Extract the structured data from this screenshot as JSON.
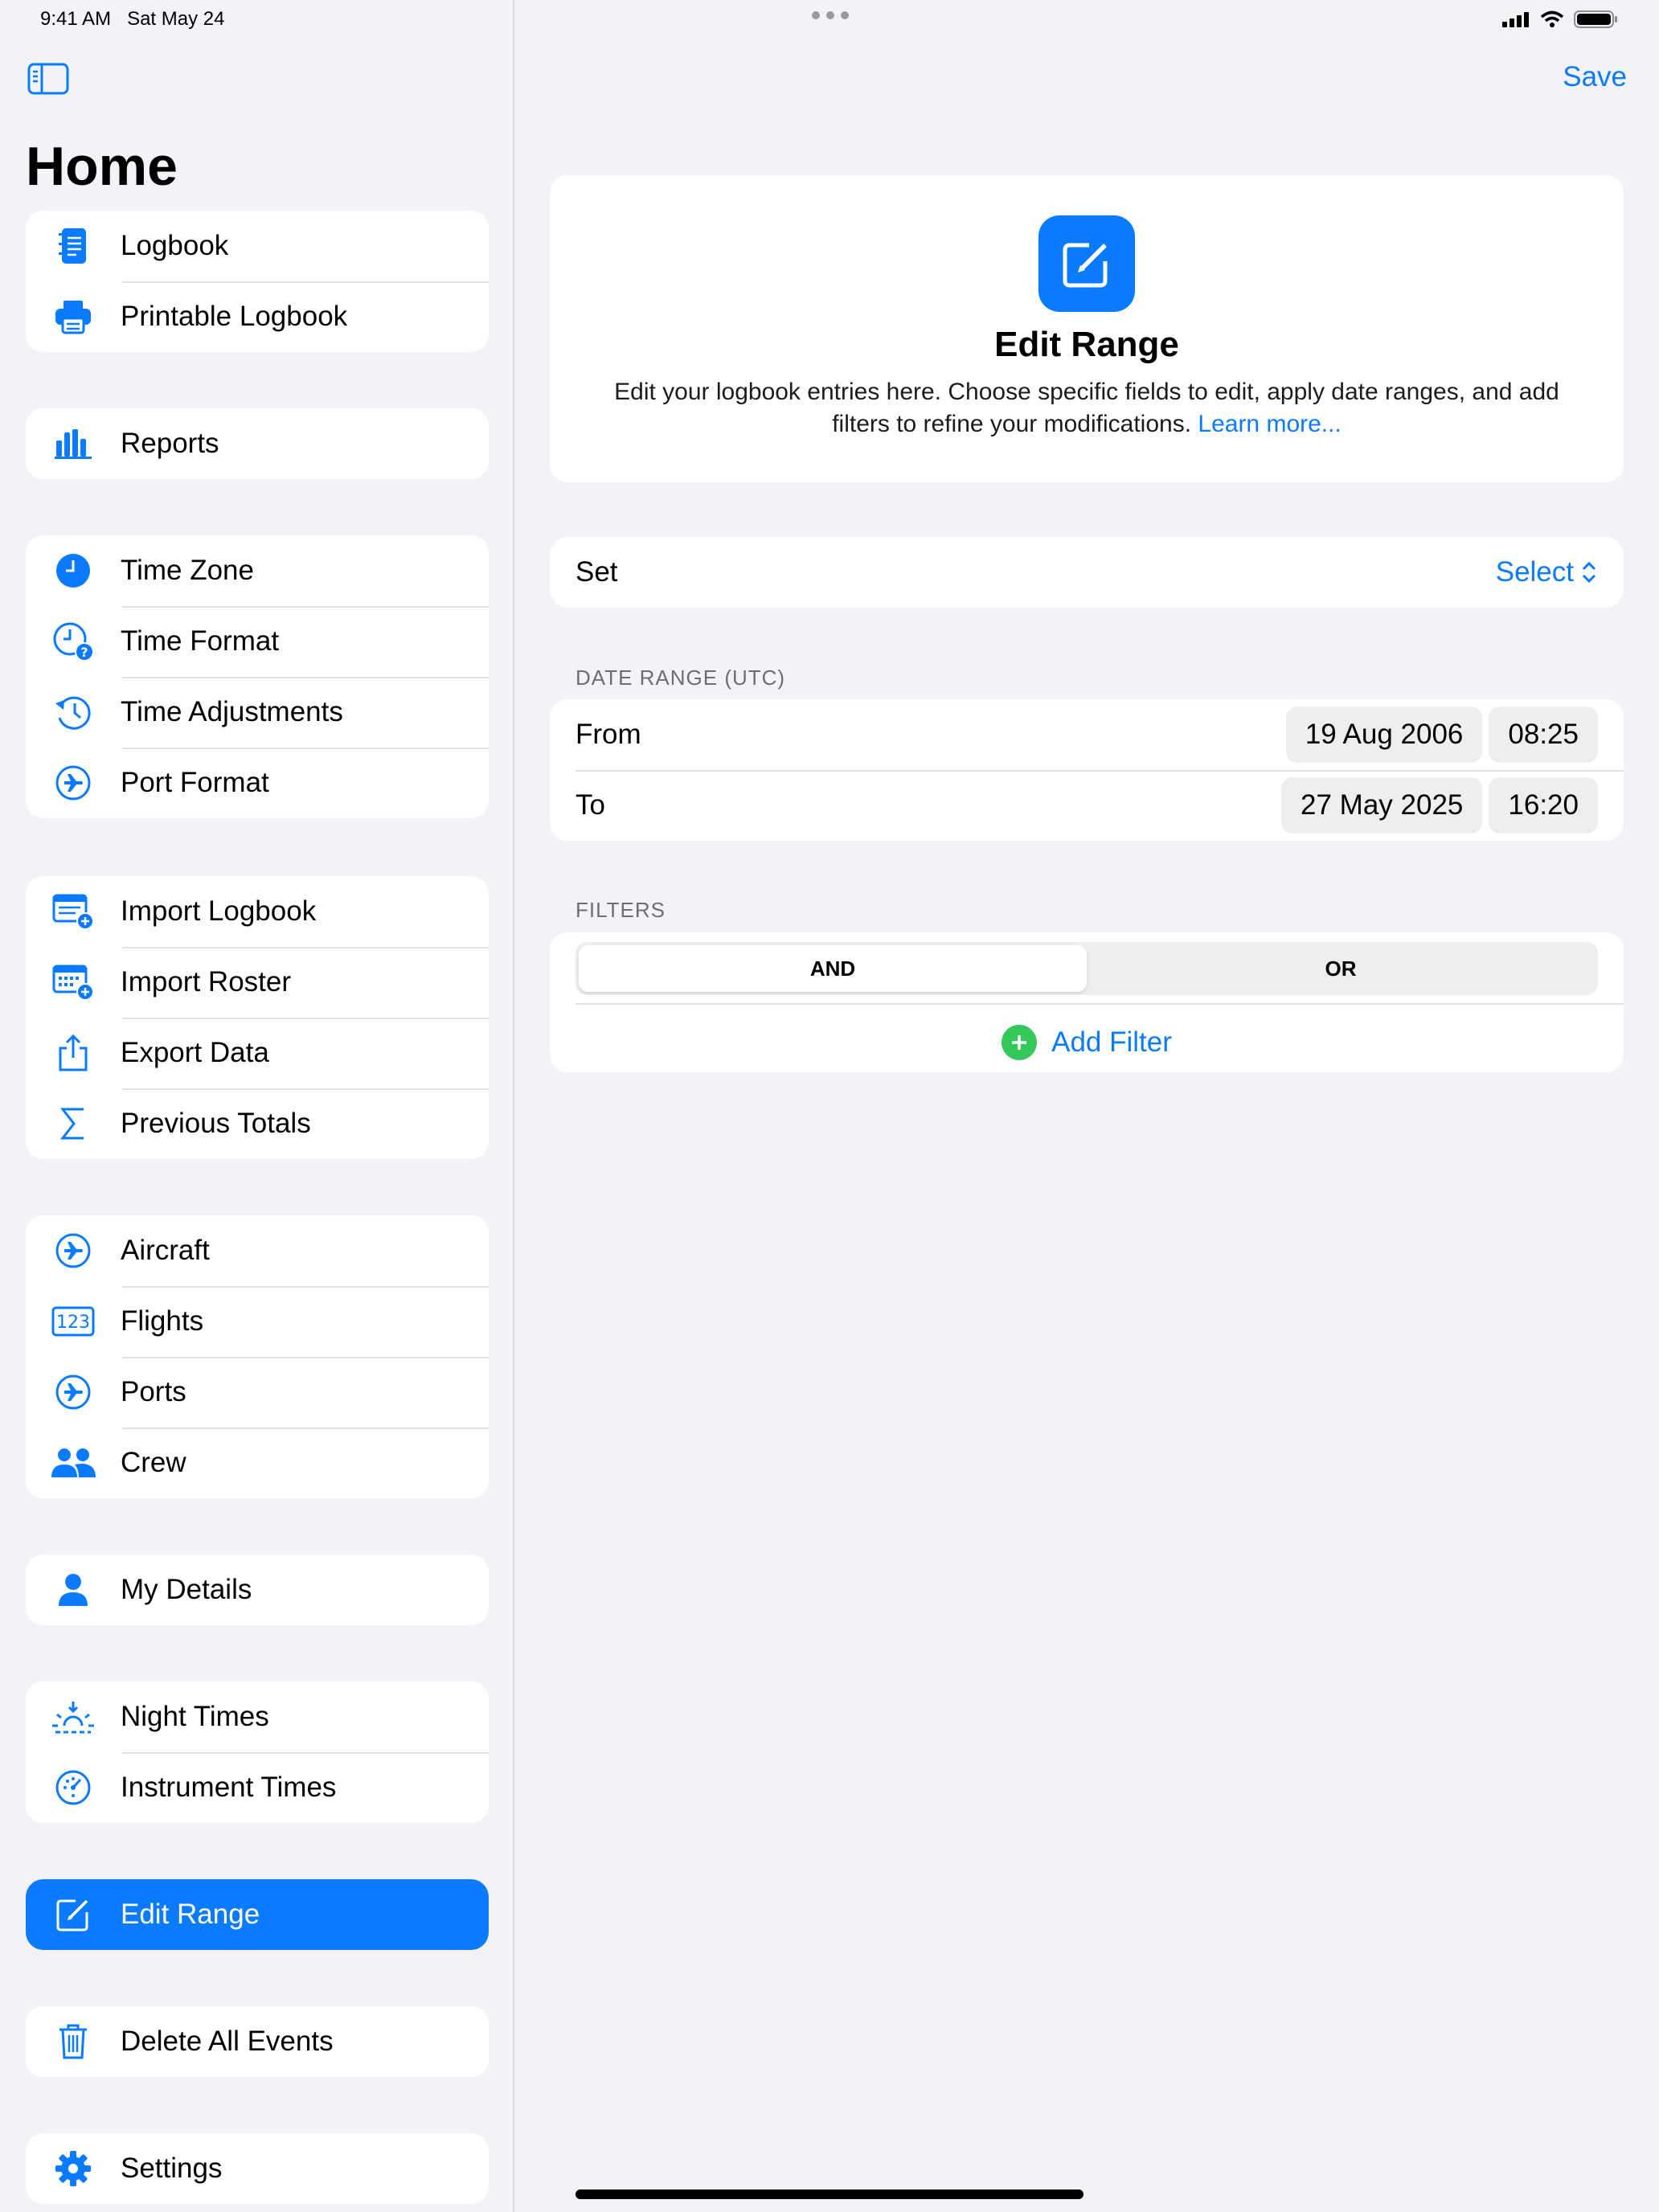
{
  "status_bar": {
    "time": "9:41 AM",
    "date": "Sat May 24"
  },
  "sidebar": {
    "title": "Home",
    "groups": [
      [
        {
          "label": "Logbook",
          "icon": "logbook-icon"
        },
        {
          "label": "Printable Logbook",
          "icon": "printer-icon"
        }
      ],
      [
        {
          "label": "Reports",
          "icon": "chart-bar-icon"
        }
      ],
      [
        {
          "label": "Time Zone",
          "icon": "clock-icon"
        },
        {
          "label": "Time Format",
          "icon": "clock-question-icon"
        },
        {
          "label": "Time Adjustments",
          "icon": "clock-arrow-icon"
        },
        {
          "label": "Port Format",
          "icon": "airplane-circle-icon"
        }
      ],
      [
        {
          "label": "Import Logbook",
          "icon": "import-list-icon"
        },
        {
          "label": "Import Roster",
          "icon": "import-calendar-icon"
        },
        {
          "label": "Export Data",
          "icon": "share-icon"
        },
        {
          "label": "Previous Totals",
          "icon": "sigma-icon"
        }
      ],
      [
        {
          "label": "Aircraft",
          "icon": "airplane-circle-icon"
        },
        {
          "label": "Flights",
          "icon": "number-123-icon"
        },
        {
          "label": "Ports",
          "icon": "airplane-circle-icon"
        },
        {
          "label": "Crew",
          "icon": "people-icon"
        }
      ],
      [
        {
          "label": "My Details",
          "icon": "person-icon"
        }
      ],
      [
        {
          "label": "Night Times",
          "icon": "sunset-icon"
        },
        {
          "label": "Instrument Times",
          "icon": "gauge-icon"
        }
      ],
      [
        {
          "label": "Edit Range",
          "icon": "edit-square-icon"
        }
      ],
      [
        {
          "label": "Delete All Events",
          "icon": "trash-icon"
        }
      ],
      [
        {
          "label": "Settings",
          "icon": "gear-icon"
        }
      ]
    ]
  },
  "toolbar": {
    "save_label": "Save"
  },
  "hero": {
    "title": "Edit Range",
    "description": "Edit your logbook entries here. Choose specific fields to edit, apply date ranges, and add filters to refine your modifications.",
    "link": "Learn more..."
  },
  "set": {
    "label": "Set",
    "value": "Select"
  },
  "date_range": {
    "header": "DATE RANGE (UTC)",
    "from": {
      "label": "From",
      "date": "19 Aug 2006",
      "time": "08:25"
    },
    "to": {
      "label": "To",
      "date": "27 May 2025",
      "time": "16:20"
    }
  },
  "filters": {
    "header": "FILTERS",
    "options": [
      "AND",
      "OR"
    ],
    "selected": "AND",
    "add_label": "Add Filter"
  },
  "colors": {
    "accent": "#0a7aff",
    "green": "#34c759",
    "background": "#f2f2f7"
  }
}
